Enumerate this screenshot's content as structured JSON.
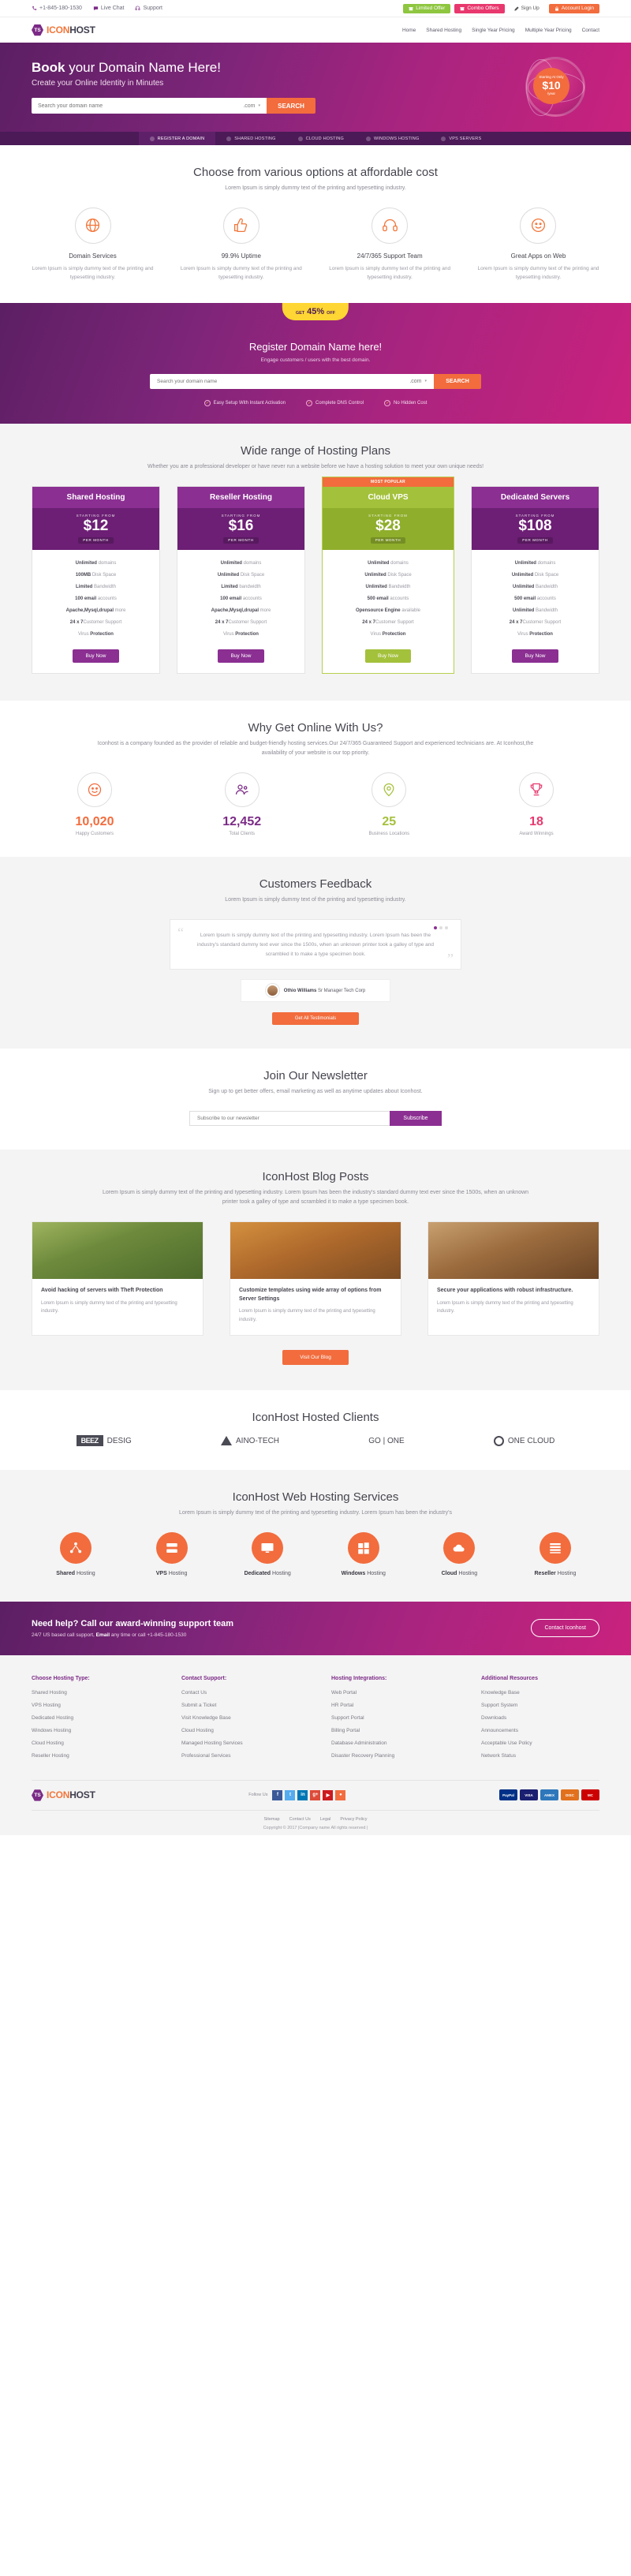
{
  "topbar": {
    "phone": "+1-845-180-1530",
    "live_chat": "Live Chat",
    "support": "Support",
    "limited_offer": "Limited Offer",
    "combo_offers": "Combo Offers",
    "sign_up": "Sign Up",
    "account_login": "Account Login"
  },
  "brand": {
    "mark": "TS",
    "icon": "ICON",
    "host": "HOST"
  },
  "nav": [
    "Home",
    "Shared Hosting",
    "Single Year Pricing",
    "Multiple Year Pricing",
    "Contact"
  ],
  "hero": {
    "title_bold": "Book",
    "title_rest": " your Domain Name Here!",
    "subtitle": "Create your Online Identity in Minutes",
    "search_placeholder": "Search your domain name",
    "tld": ".com",
    "search_button": "SEARCH",
    "badge_top": "Starting At Only",
    "badge_price": "$10",
    "badge_bottom": "/year",
    "tabs": [
      "REGISTER A DOMAIN",
      "SHARED HOSTING",
      "CLOUD HOSTING",
      "WINDOWS HOSTING",
      "VPS SERVERS"
    ]
  },
  "features": {
    "title": "Choose from various options at affordable cost",
    "subtitle": "Lorem Ipsum is simply dummy text of the printing and typesetting industry.",
    "items": [
      {
        "icon": "globe-icon",
        "title": "Domain Services",
        "text": "Lorem Ipsum is simply dummy text of the printing and typesetting industry."
      },
      {
        "icon": "thumbs-up-icon",
        "title": "99.9% Uptime",
        "text": "Lorem Ipsum is simply dummy text of the printing and typesetting industry."
      },
      {
        "icon": "headset-icon",
        "title": "24/7/365 Support Team",
        "text": "Lorem Ipsum is simply dummy text of the printing and typesetting industry."
      },
      {
        "icon": "smile-icon",
        "title": "Great Apps on Web",
        "text": "Lorem Ipsum is simply dummy text of the printing and typesetting industry."
      }
    ]
  },
  "register": {
    "offer_get": "GET",
    "offer_percent": "45%",
    "offer_off": "OFF",
    "title": "Register Domain Name here!",
    "subtitle": "Engage customers / users with the best domain.",
    "placeholder": "Search your domain name",
    "tld": ".com",
    "button": "SEARCH",
    "perks": [
      "Easy Setup With Instant Activation",
      "Complete DNS Control",
      "No Hidden Cost"
    ]
  },
  "pricing": {
    "title": "Wide range of Hosting Plans",
    "subtitle": "Whether you are a professional developer or have never run a website before we have a hosting solution to meet your own unique needs!",
    "starting_label": "STARTING FROM",
    "per_month": "PER MONTH",
    "buy_label": "Buy Now",
    "most_popular": "MOST POPULAR",
    "plans": [
      {
        "name": "Shared Hosting",
        "price": "$12",
        "featured": false,
        "features": [
          [
            "Unlimited",
            " domains"
          ],
          [
            "100MB",
            " Disk Space"
          ],
          [
            "Limited",
            " Bandwidth"
          ],
          [
            "100 email",
            " accounts"
          ],
          [
            "Apache,Mysql,drupal",
            " more"
          ],
          [
            "24 x 7",
            "Customer Support"
          ],
          [
            "Virus ",
            "Protection"
          ]
        ]
      },
      {
        "name": "Reseller Hosting",
        "price": "$16",
        "featured": false,
        "features": [
          [
            "Unlimited",
            " domains"
          ],
          [
            "Unlimited",
            " Disk Space"
          ],
          [
            "Limited",
            " bandwidth"
          ],
          [
            "100 email",
            " accounts"
          ],
          [
            "Apache,Mysql,drupal",
            " more"
          ],
          [
            "24 x 7",
            "Customer Support"
          ],
          [
            "Virus ",
            "Protection"
          ]
        ]
      },
      {
        "name": "Cloud VPS",
        "price": "$28",
        "featured": true,
        "features": [
          [
            "Unlimited",
            " domains"
          ],
          [
            "Unlimited",
            " Disk Space"
          ],
          [
            "Unlimited",
            " Bandwidth"
          ],
          [
            "500 email",
            " accounts"
          ],
          [
            "Opensource Engine",
            " available"
          ],
          [
            "24 x 7",
            "Customer Support"
          ],
          [
            "Virus ",
            "Protection"
          ]
        ]
      },
      {
        "name": "Dedicated Servers",
        "price": "$108",
        "featured": false,
        "features": [
          [
            "Unlimited",
            " domains"
          ],
          [
            "Unlimited",
            " Disk Space"
          ],
          [
            "Unlimited",
            " Bandwidth"
          ],
          [
            "500 email",
            " accounts"
          ],
          [
            "Unlimited",
            " Bandwidth"
          ],
          [
            "24 x 7",
            "Customer Support"
          ],
          [
            "Virus ",
            "Protection"
          ]
        ]
      }
    ]
  },
  "why": {
    "title": "Why Get Online With Us?",
    "subtitle": "Iconhost is a company founded as the provider of reliable and budget-friendly hosting services.Our 24/7/365 Guaranteed Support and experienced technicians are. At Iconhost,the availability of your website is our top priority.",
    "stats": [
      {
        "icon": "smile-icon",
        "num": "10,020",
        "label": "Happy Customers",
        "color": "#f26c3d"
      },
      {
        "icon": "users-icon",
        "num": "12,452",
        "label": "Total Clients",
        "color": "#7b2a86"
      },
      {
        "icon": "map-pin-icon",
        "num": "25",
        "label": "Business Locations",
        "color": "#a4c13c"
      },
      {
        "icon": "trophy-icon",
        "num": "18",
        "label": "Award Winnings",
        "color": "#e8386e"
      }
    ]
  },
  "testimonial": {
    "title": "Customers Feedback",
    "subtitle": "Lorem Ipsum is simply dummy text of the printing and typesetting industry.",
    "quote": "Lorem Ipsum is simply dummy text of the printing and typesetting industry. Lorem Ipsum has been the industry's standard dummy text ever since the 1500s, when an unknown printer took a galley of type and scrambled it to make a type specimen book.",
    "author_name": "Othio Williams",
    "author_role": "Sr Manager Tech Corp",
    "button": "Get All Testimonials"
  },
  "newsletter": {
    "title": "Join Our Newsletter",
    "subtitle": "Sign up to get better offers, email marketing as well as anytime updates about Iconhost.",
    "placeholder": "Subscribe to our newsletter",
    "button": "Subscribe"
  },
  "blog": {
    "title": "IconHost Blog Posts",
    "subtitle": "Lorem Ipsum is simply dummy text of the printing and typesetting industry. Lorem Ipsum has been the industry's standard dummy text ever since the 1500s, when an unknown printer took a galley of type and scrambled it to make a type specimen book.",
    "posts": [
      {
        "title": "Avoid hacking of servers with Theft Protection",
        "text": "Lorem Ipsum is simply dummy text of the printing and typesetting industry."
      },
      {
        "title": "Customize templates using wide array of options from Server Settings",
        "text": "Lorem Ipsum is simply dummy text of the printing and typesetting industry."
      },
      {
        "title": "Secure your applications with robust infrastructure.",
        "text": "Lorem Ipsum is simply dummy text of the printing and typesetting industry."
      }
    ],
    "button": "Visit Our Blog"
  },
  "clients": {
    "title": "IconHost Hosted Clients",
    "items": [
      {
        "badge": "BEEZ",
        "rest": "DESIG"
      },
      {
        "badge": "",
        "rest": "AINO-TECH"
      },
      {
        "badge": "",
        "rest": "GO | ONE"
      },
      {
        "badge": "",
        "rest": "ONE CLOUD"
      }
    ]
  },
  "services": {
    "title": "IconHost Web Hosting Services",
    "subtitle": "Lorem Ipsum is simply dummy text of the printing and typesetting industry. Lorem Ipsum has been the industry's",
    "items": [
      {
        "icon": "network-icon",
        "bold": "Shared",
        "rest": " Hosting"
      },
      {
        "icon": "server-icon",
        "bold": "VPS",
        "rest": " Hosting"
      },
      {
        "icon": "monitor-icon",
        "bold": "Dedicated",
        "rest": " Hosting"
      },
      {
        "icon": "windows-icon",
        "bold": "Windows",
        "rest": " Hosting"
      },
      {
        "icon": "cloud-icon",
        "bold": "Cloud",
        "rest": " Hosting"
      },
      {
        "icon": "database-icon",
        "bold": "Reseller",
        "rest": " Hosting"
      }
    ]
  },
  "cta": {
    "title": "Need help? Call our award-winning support team",
    "sub_pre": "24/7 US based call support, ",
    "sub_bold": "Email",
    "sub_post": " any time or call +1-845-180-1530",
    "button": "Contact Iconhost"
  },
  "footer": {
    "columns": [
      {
        "heading": "Choose Hosting Type:",
        "links": [
          "Shared Hosting",
          "VPS Hosting",
          "Dedicated Hosting",
          "Windows Hosting",
          "Cloud Hosting",
          "Reseller Hosting"
        ]
      },
      {
        "heading": "Contact Support:",
        "links": [
          "Contact Us",
          "Submit a Ticket",
          "Visit Knowledge Base",
          "Cloud Hosting",
          "Managed Hosting Services",
          "Professional Services"
        ]
      },
      {
        "heading": "Hosting Integrations:",
        "links": [
          "Web Portal",
          "HR Portal",
          "Support Portal",
          "Billing Portal",
          "Database Administration",
          "Disaster Recovery Planning"
        ]
      },
      {
        "heading": "Additional Resources",
        "links": [
          "Knowledge Base",
          "Support System",
          "Downloads",
          "Announcements",
          "Acceptable Use Policy",
          "Network Status"
        ]
      }
    ],
    "follow_label": "Follow Us",
    "social": [
      {
        "name": "facebook-icon",
        "glyph": "f",
        "color": "#3b5998"
      },
      {
        "name": "twitter-icon",
        "glyph": "t",
        "color": "#55acee"
      },
      {
        "name": "linkedin-icon",
        "glyph": "in",
        "color": "#0077b5"
      },
      {
        "name": "google-plus-icon",
        "glyph": "g+",
        "color": "#dd4b39"
      },
      {
        "name": "youtube-icon",
        "glyph": "▶",
        "color": "#cc181e"
      },
      {
        "name": "rss-icon",
        "glyph": "●",
        "color": "#f26c3d"
      }
    ],
    "payments": [
      {
        "name": "paypal-icon",
        "label": "PayPal",
        "color": "#003087"
      },
      {
        "name": "visa-icon",
        "label": "VISA",
        "color": "#1a1f71"
      },
      {
        "name": "amex-icon",
        "label": "AMEX",
        "color": "#2e77bb"
      },
      {
        "name": "discover-icon",
        "label": "DISC",
        "color": "#e2711d"
      },
      {
        "name": "mastercard-icon",
        "label": "MC",
        "color": "#cc0000"
      }
    ],
    "bottom_links": [
      "Sitemap",
      "Contact Us",
      "Legal",
      "Privacy Policy"
    ],
    "copyright": "Copyright © 2017 |Company name All rights reserved |"
  }
}
